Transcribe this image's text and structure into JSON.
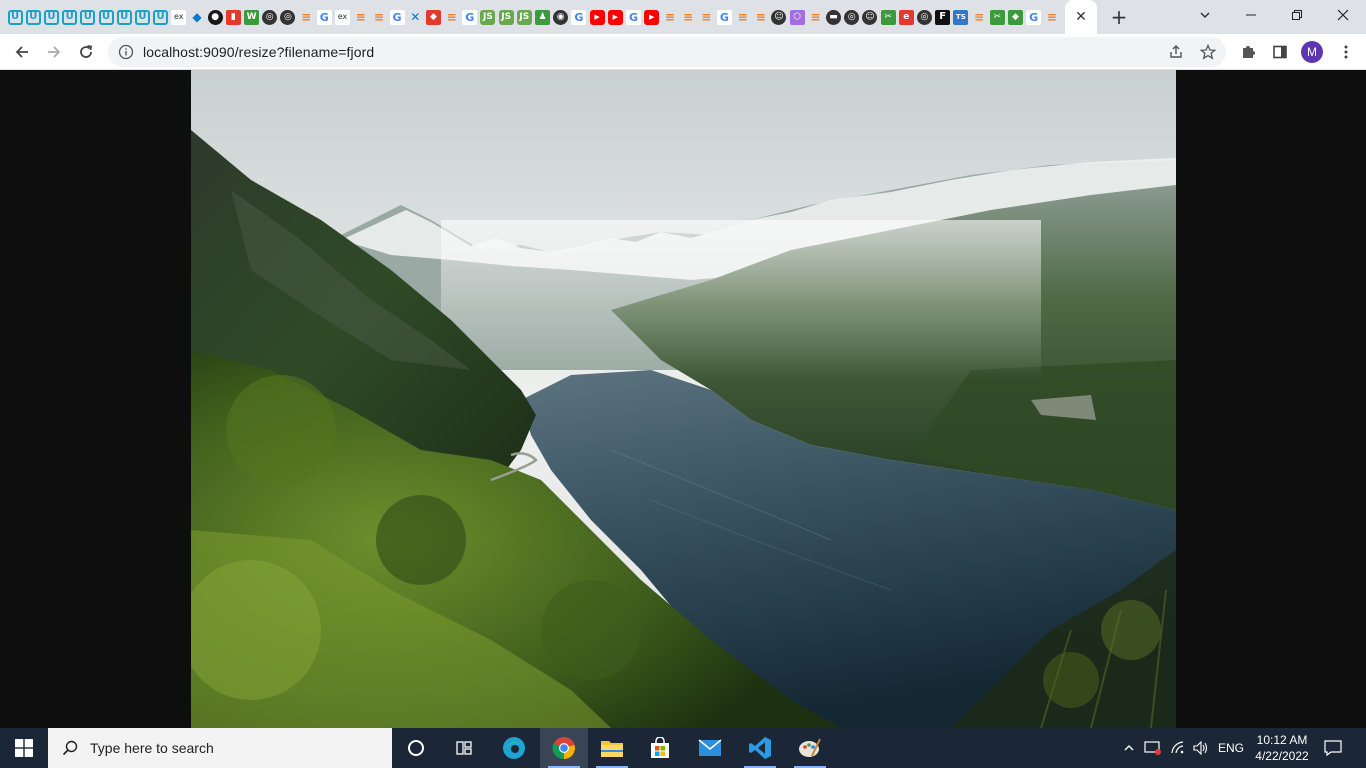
{
  "browser": {
    "tab_favicons": [
      {
        "icon": "u",
        "glyph": "U"
      },
      {
        "icon": "u",
        "glyph": "U"
      },
      {
        "icon": "u",
        "glyph": "U"
      },
      {
        "icon": "u",
        "glyph": "U"
      },
      {
        "icon": "u",
        "glyph": "U"
      },
      {
        "icon": "u",
        "glyph": "U"
      },
      {
        "icon": "u",
        "glyph": "U"
      },
      {
        "icon": "u",
        "glyph": "U"
      },
      {
        "icon": "u",
        "glyph": "U"
      },
      {
        "icon": "ex",
        "glyph": "ex"
      },
      {
        "icon": "vs",
        "glyph": "◆"
      },
      {
        "icon": "gh",
        "glyph": "●"
      },
      {
        "icon": "red",
        "glyph": "▮"
      },
      {
        "icon": "green",
        "glyph": "W"
      },
      {
        "icon": "dark",
        "glyph": "◎"
      },
      {
        "icon": "dark",
        "glyph": "◎"
      },
      {
        "icon": "so",
        "glyph": "≡"
      },
      {
        "icon": "g",
        "glyph": "G"
      },
      {
        "icon": "ex",
        "glyph": "ex"
      },
      {
        "icon": "so",
        "glyph": "≡"
      },
      {
        "icon": "so",
        "glyph": "≡"
      },
      {
        "icon": "g",
        "glyph": "G"
      },
      {
        "icon": "vs",
        "glyph": "✕"
      },
      {
        "icon": "red",
        "glyph": "◆"
      },
      {
        "icon": "so",
        "glyph": "≡"
      },
      {
        "icon": "g",
        "glyph": "G"
      },
      {
        "icon": "node",
        "glyph": "JS"
      },
      {
        "icon": "node",
        "glyph": "JS"
      },
      {
        "icon": "node",
        "glyph": "JS"
      },
      {
        "icon": "green",
        "glyph": "♟"
      },
      {
        "icon": "dark",
        "glyph": "◉"
      },
      {
        "icon": "g",
        "glyph": "G"
      },
      {
        "icon": "yt",
        "glyph": "▶"
      },
      {
        "icon": "yt",
        "glyph": "▶"
      },
      {
        "icon": "g",
        "glyph": "G"
      },
      {
        "icon": "yt",
        "glyph": "▶"
      },
      {
        "icon": "so",
        "glyph": "≡"
      },
      {
        "icon": "so",
        "glyph": "≡"
      },
      {
        "icon": "so",
        "glyph": "≡"
      },
      {
        "icon": "g",
        "glyph": "G"
      },
      {
        "icon": "so",
        "glyph": "≡"
      },
      {
        "icon": "so",
        "glyph": "≡"
      },
      {
        "icon": "dark",
        "glyph": "☺"
      },
      {
        "icon": "purple",
        "glyph": "⬡"
      },
      {
        "icon": "so",
        "glyph": "≡"
      },
      {
        "icon": "dark",
        "glyph": "▬"
      },
      {
        "icon": "dark",
        "glyph": "◎"
      },
      {
        "icon": "dark",
        "glyph": "☺"
      },
      {
        "icon": "green",
        "glyph": "✂"
      },
      {
        "icon": "red",
        "glyph": "e"
      },
      {
        "icon": "dark",
        "glyph": "◎"
      },
      {
        "icon": "f",
        "glyph": "F"
      },
      {
        "icon": "ts",
        "glyph": "TS"
      },
      {
        "icon": "so",
        "glyph": "≡"
      },
      {
        "icon": "green",
        "glyph": "✂"
      },
      {
        "icon": "green",
        "glyph": "◆"
      },
      {
        "icon": "g",
        "glyph": "G"
      },
      {
        "icon": "so",
        "glyph": "≡"
      },
      {
        "icon": "so",
        "glyph": "≡"
      }
    ],
    "active_tab_close": "✕",
    "new_tab": "+",
    "url": "localhost:9090/resize?filename=fjord",
    "profile_initial": "M"
  },
  "taskbar": {
    "search_placeholder": "Type here to search",
    "language": "ENG",
    "time": "10:12 AM",
    "date": "4/22/2022"
  }
}
